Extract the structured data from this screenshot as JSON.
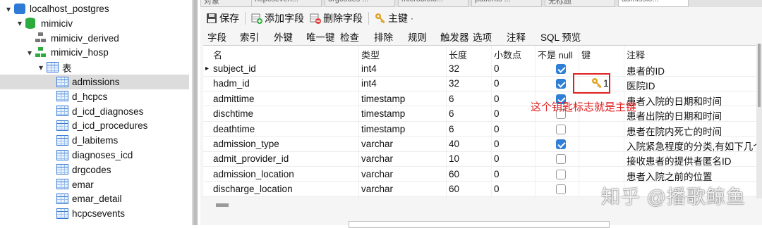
{
  "tree": {
    "items": [
      {
        "label": "localhost_postgres",
        "level": 0,
        "chevron": "▾",
        "icon": "server-icon"
      },
      {
        "label": "mimiciv",
        "level": 1,
        "chevron": "▾",
        "icon": "database-icon"
      },
      {
        "label": "mimiciv_derived",
        "level": 2,
        "chevron": "",
        "icon": "schema-icon"
      },
      {
        "label": "mimiciv_hosp",
        "level": 2,
        "chevron": "▾",
        "icon": "schema-icon"
      },
      {
        "label": "表",
        "level": 3,
        "chevron": "▾",
        "icon": "tables-folder-icon"
      },
      {
        "label": "admissions",
        "level": 4,
        "chevron": "",
        "icon": "table-icon",
        "selected": true
      },
      {
        "label": "d_hcpcs",
        "level": 4,
        "chevron": "",
        "icon": "table-icon"
      },
      {
        "label": "d_icd_diagnoses",
        "level": 4,
        "chevron": "",
        "icon": "table-icon"
      },
      {
        "label": "d_icd_procedures",
        "level": 4,
        "chevron": "",
        "icon": "table-icon"
      },
      {
        "label": "d_labitems",
        "level": 4,
        "chevron": "",
        "icon": "table-icon"
      },
      {
        "label": "diagnoses_icd",
        "level": 4,
        "chevron": "",
        "icon": "table-icon"
      },
      {
        "label": "drgcodes",
        "level": 4,
        "chevron": "",
        "icon": "table-icon"
      },
      {
        "label": "emar",
        "level": 4,
        "chevron": "",
        "icon": "table-icon"
      },
      {
        "label": "emar_detail",
        "level": 4,
        "chevron": "",
        "icon": "table-icon"
      },
      {
        "label": "hcpcsevents",
        "level": 4,
        "chevron": "",
        "icon": "table-icon"
      }
    ]
  },
  "tabs": [
    "对象",
    "hcpcseven...",
    "drgcodes ...",
    "microbiolo...",
    "patients ...",
    "无标题",
    "admissio..."
  ],
  "toolbar": {
    "save_label": "保存",
    "add_field_label": "添加字段",
    "delete_field_label": "删除字段",
    "primary_key_label": "主键",
    "primary_key_caret": "·"
  },
  "subtabs": [
    "字段",
    "索引",
    "外键",
    "唯一键",
    "检查",
    "排除",
    "规则",
    "触发器",
    "选项",
    "注释",
    "SQL 预览"
  ],
  "grid": {
    "headers": [
      "名",
      "类型",
      "长度",
      "小数点",
      "不是 null",
      "键",
      "注释"
    ],
    "current_row_marker": "▸",
    "rows": [
      {
        "name": "subject_id",
        "type": "int4",
        "length": "32",
        "decimals": "0",
        "not_null": true,
        "key": "",
        "comment": "患者的ID"
      },
      {
        "name": "hadm_id",
        "type": "int4",
        "length": "32",
        "decimals": "0",
        "not_null": true,
        "key": "1",
        "comment": "医院ID"
      },
      {
        "name": "admittime",
        "type": "timestamp",
        "length": "6",
        "decimals": "0",
        "not_null": true,
        "key": "",
        "comment": "患者入院的日期和时间"
      },
      {
        "name": "dischtime",
        "type": "timestamp",
        "length": "6",
        "decimals": "0",
        "not_null": false,
        "key": "",
        "comment": "患者出院的日期和时间"
      },
      {
        "name": "deathtime",
        "type": "timestamp",
        "length": "6",
        "decimals": "0",
        "not_null": false,
        "key": "",
        "comment": "患者在院内死亡的时间"
      },
      {
        "name": "admission_type",
        "type": "varchar",
        "length": "40",
        "decimals": "0",
        "not_null": true,
        "key": "",
        "comment": "入院紧急程度的分类,有如下几个"
      },
      {
        "name": "admit_provider_id",
        "type": "varchar",
        "length": "10",
        "decimals": "0",
        "not_null": false,
        "key": "",
        "comment": "接收患者的提供者匿名ID"
      },
      {
        "name": "admission_location",
        "type": "varchar",
        "length": "60",
        "decimals": "0",
        "not_null": false,
        "key": "",
        "comment": "患者入院之前的位置"
      },
      {
        "name": "discharge_location",
        "type": "varchar",
        "length": "60",
        "decimals": "0",
        "not_null": false,
        "key": "",
        "comment": ""
      }
    ]
  },
  "annotation": {
    "text": "这个钥匙标志就是主键",
    "color": "#e02020"
  },
  "watermark": "知乎 @播歌鲸鱼",
  "colors": {
    "accent": "#2f7fd6",
    "annotation": "#e02020",
    "key": "#e0a020",
    "selected_row": "#dcdcdc"
  }
}
